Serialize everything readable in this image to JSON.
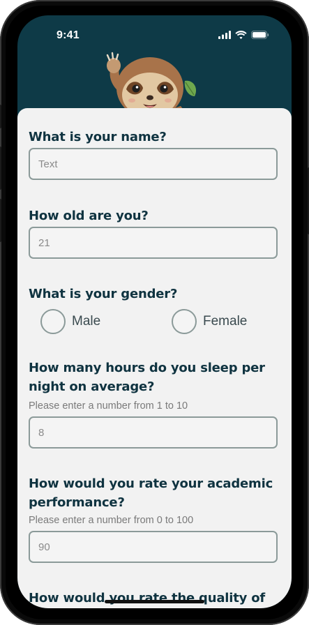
{
  "status_bar": {
    "time": "9:41"
  },
  "form": {
    "name": {
      "question": "What is your name?",
      "placeholder": "Text"
    },
    "age": {
      "question": "How old are you?",
      "placeholder": "21"
    },
    "gender": {
      "question": "What is your gender?",
      "options": [
        "Male",
        "Female"
      ]
    },
    "sleep": {
      "question_line1": "How many hours do you sleep per",
      "question_line2": "night on average?",
      "hint": "Please enter a number from 1 to 10",
      "placeholder": "8"
    },
    "academic": {
      "question_line1": "How would you rate your academic",
      "question_line2": "performance?",
      "hint": "Please enter a number from 0 to 100",
      "placeholder": "90"
    },
    "next_question_partial": "How would you rate the quality of"
  },
  "colors": {
    "header_bg": "#0e3a47",
    "card_bg": "#f2f2f2",
    "label_color": "#0f3340",
    "border_color": "#8b9a99"
  }
}
